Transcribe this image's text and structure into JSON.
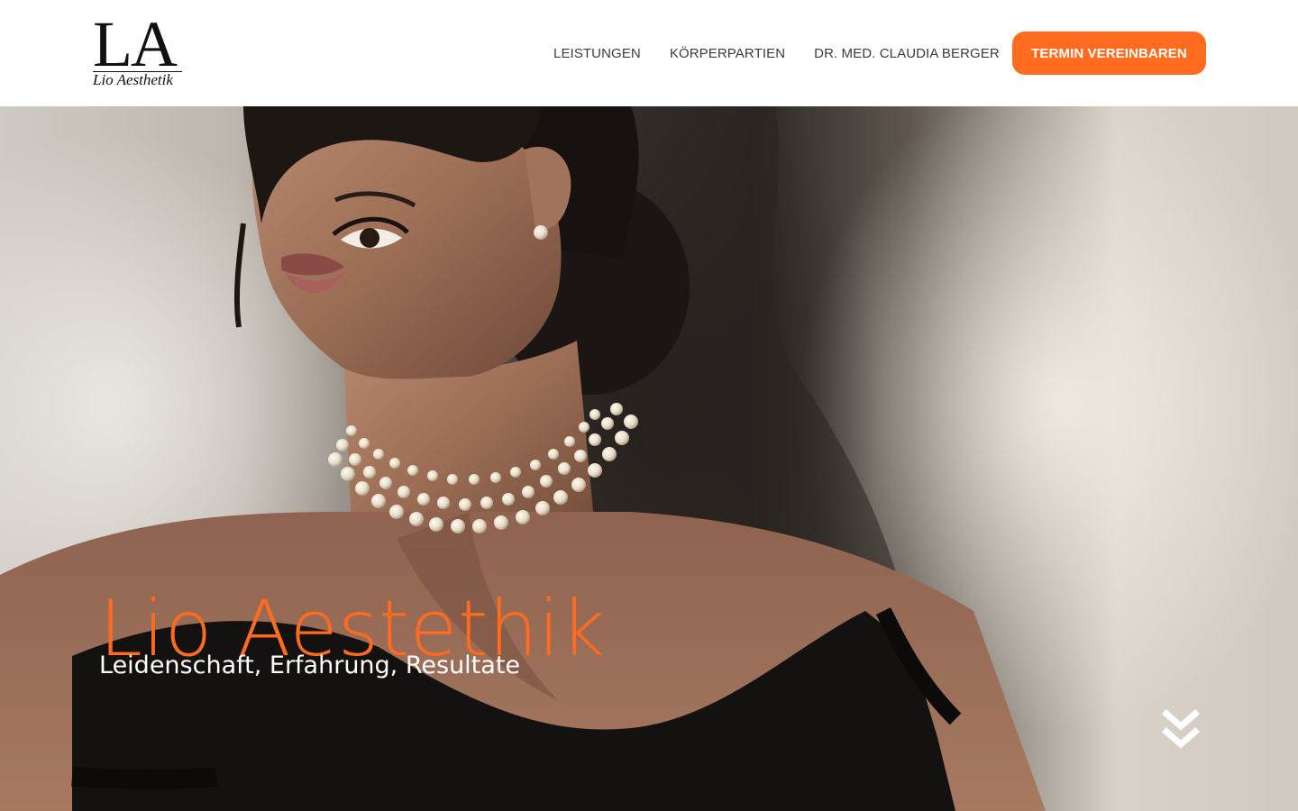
{
  "header": {
    "logo": {
      "mark": "LA",
      "subtitle": "Lio Aesthetik"
    },
    "nav": [
      {
        "label": "LEISTUNGEN"
      },
      {
        "label": "KÖRPERPARTIEN"
      },
      {
        "label": "DR. MED. CLAUDIA BERGER"
      }
    ],
    "cta_label": "TERMIN VEREINBAREN"
  },
  "hero": {
    "title": "Lio Aestethik",
    "subtitle": "Leidenschaft, Erfahrung, Resultate",
    "scroll_icon": "double-chevron-down-icon"
  },
  "colors": {
    "accent": "#ff6b1f",
    "nav_text": "#3b3b3b",
    "hero_subtitle": "#ffffff"
  }
}
